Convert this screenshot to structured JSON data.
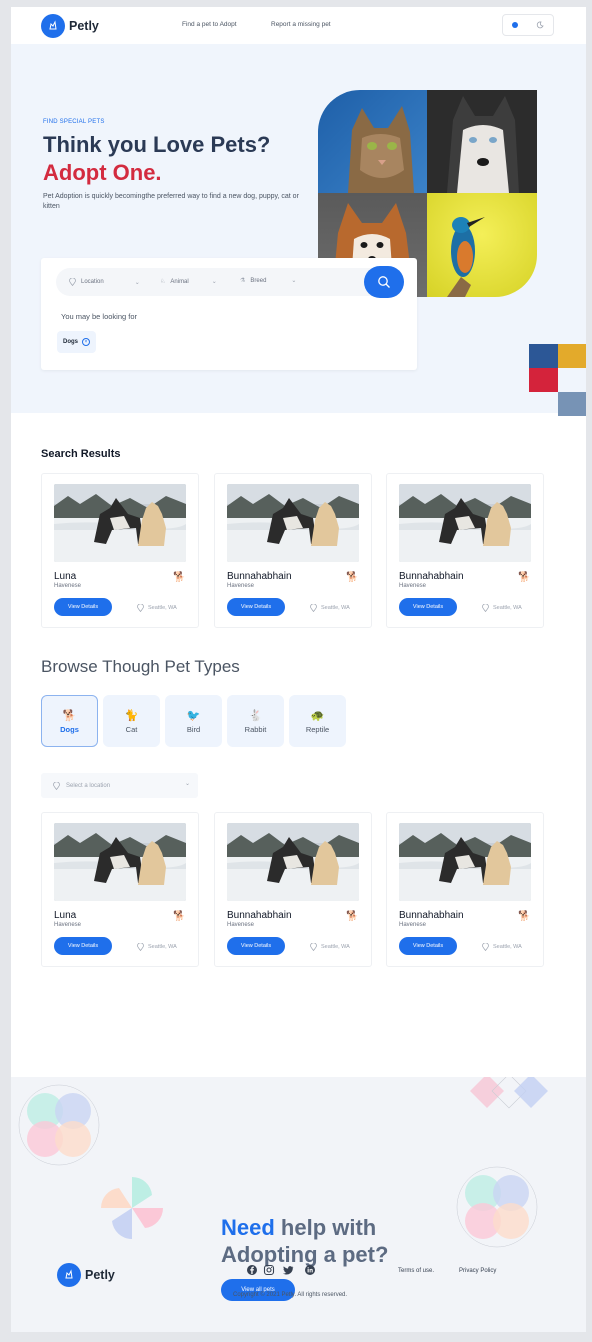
{
  "header": {
    "logo_text": "Petly",
    "nav": [
      "Find a pet to Adopt",
      "Report a missing pet"
    ]
  },
  "hero": {
    "eyebrow": "FIND SPECIAL PETS",
    "title_line1": "Think you Love Pets?",
    "title_line2": "Adopt One.",
    "description": "Pet Adoption is quickly becomingthe preferred way to find a new dog, puppy, cat or kitten"
  },
  "search": {
    "location": "Location",
    "animal": "Animal",
    "breed": "Breed",
    "looking_for": "You may be looking for",
    "chip": "Dogs"
  },
  "results": {
    "title": "Search Results",
    "cards": [
      {
        "name": "Luna",
        "breed": "Havenese",
        "button": "View Details",
        "location": "Seattle, WA"
      },
      {
        "name": "Bunnahabhain",
        "breed": "Havenese",
        "button": "View Details",
        "location": "Seattle, WA"
      },
      {
        "name": "Bunnahabhain",
        "breed": "Havenese",
        "button": "View Details",
        "location": "Seattle, WA"
      }
    ]
  },
  "browse": {
    "title": "Browse Though Pet Types",
    "types": [
      {
        "label": "Dogs",
        "icon": "dog-icon",
        "active": true
      },
      {
        "label": "Cat",
        "icon": "cat-icon",
        "active": false
      },
      {
        "label": "Bird",
        "icon": "bird-icon",
        "active": false
      },
      {
        "label": "Rabbit",
        "icon": "rabbit-icon",
        "active": false
      },
      {
        "label": "Reptile",
        "icon": "reptile-icon",
        "active": false
      }
    ],
    "location_placeholder": "Select a location",
    "cards": [
      {
        "name": "Luna",
        "breed": "Havenese",
        "button": "View Details",
        "location": "Seattle, WA"
      },
      {
        "name": "Bunnahabhain",
        "breed": "Havenese",
        "button": "View Details",
        "location": "Seattle, WA"
      },
      {
        "name": "Bunnahabhain",
        "breed": "Havenese",
        "button": "View Details",
        "location": "Seattle, WA"
      }
    ]
  },
  "footer": {
    "need": "Need",
    "help_rest": "help with",
    "help_line2": "Adopting a pet?",
    "all_pets": "View all pets",
    "logo_text": "Petly",
    "terms": "Terms of use.",
    "privacy": "Privacy Policy",
    "copyright": "Copyright © 2021 Petly. All rights reserved."
  },
  "colors": {
    "accent": "#1f6feb",
    "adopt_red": "#d32b3f",
    "hero_bg": "#f0f5fc",
    "footer_bg": "#f2f4f8"
  }
}
